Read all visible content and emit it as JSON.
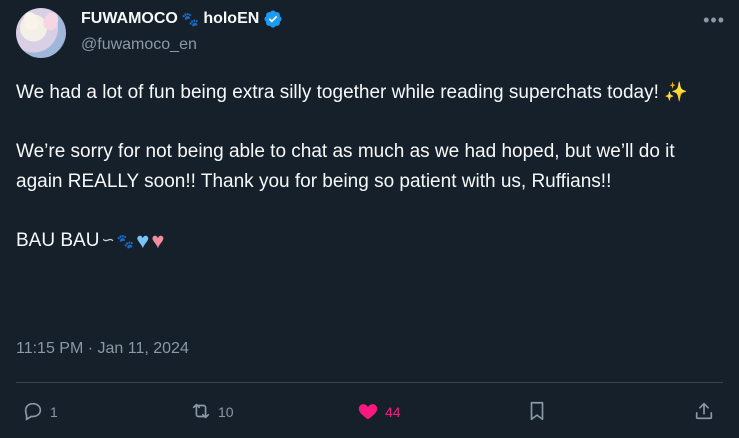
{
  "author": {
    "display_name": "FUWAMOCO",
    "name_suffix": "holoEN",
    "name_emoji": "🐾",
    "handle": "@fuwamoco_en",
    "verified": true
  },
  "tweet": {
    "para1": "We had a lot of fun being extra silly together while reading superchats today!",
    "para1_emoji": "✨",
    "para2": "We’re sorry for not being able to chat as much as we had hoped, but we’ll do it again REALLY soon!! Thank you for being so patient with us, Ruffians!!",
    "signoff": "BAU BAU",
    "signoff_wave": "∽",
    "signoff_paw": "🐾",
    "heart_blue": "♥",
    "heart_pink": "♥",
    "timestamp": "11:15 PM · Jan 11, 2024"
  },
  "actions": {
    "reply_count": "1",
    "repost_count": "10",
    "like_count": "44"
  },
  "colors": {
    "background": "#15202b",
    "text": "#f7f9f9",
    "muted": "#8b98a5",
    "like": "#f91880",
    "verified": "#1d9bf0"
  },
  "icons": {
    "more": "more-icon",
    "reply": "reply-icon",
    "repost": "repost-icon",
    "like": "heart-icon",
    "bookmark": "bookmark-icon",
    "share": "share-icon"
  }
}
